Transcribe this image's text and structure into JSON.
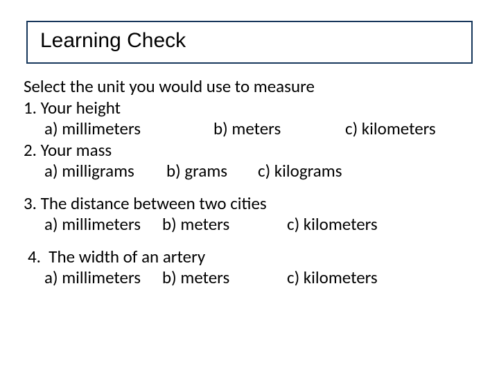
{
  "title": "Learning Check",
  "prompt": "Select the unit you would use to measure",
  "questions": [
    {
      "num": "1.",
      "text": "Your height",
      "a": "a) millimeters",
      "b": "b) meters",
      "c": "c) kilometers"
    },
    {
      "num": "2.",
      "text": "Your mass",
      "a": "a) milligrams",
      "b": "b) grams",
      "c": "c) kilograms"
    },
    {
      "num": "3.",
      "text": "The distance between two cities",
      "a": "a) millimeters",
      "b": "b) meters",
      "c": "c) kilometers"
    },
    {
      "num": "4.",
      "text": "The width of an artery",
      "a": "a) millimeters",
      "b": "b) meters",
      "c": "c) kilometers"
    }
  ]
}
